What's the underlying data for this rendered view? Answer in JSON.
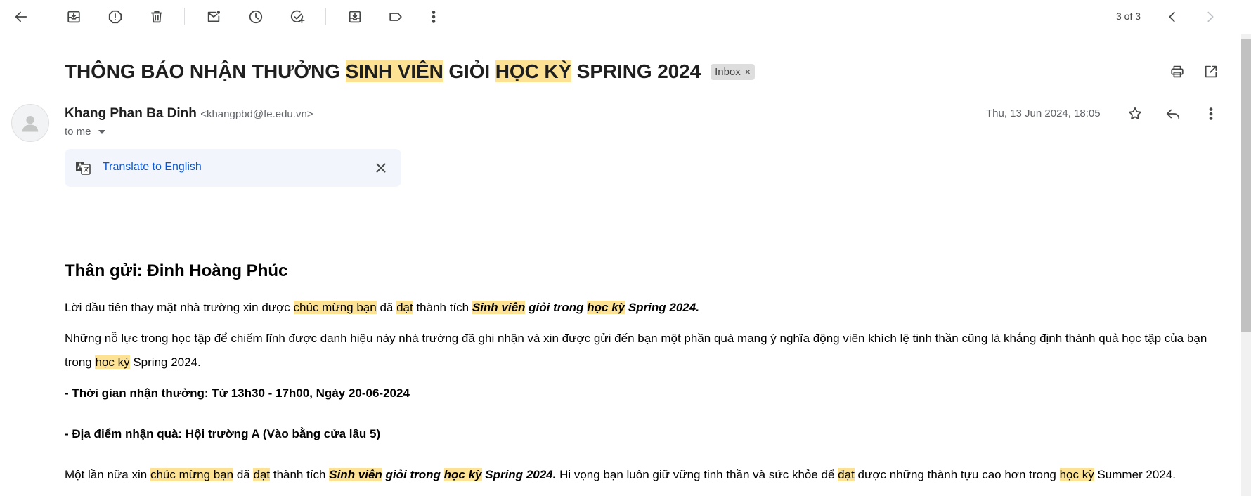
{
  "toolbar": {
    "pager_text": "3 of 3",
    "icons": [
      "back-icon",
      "archive-icon",
      "report-spam-icon",
      "delete-icon",
      "mark-unread-icon",
      "snooze-icon",
      "add-task-icon",
      "move-to-icon",
      "label-icon",
      "more-vert-icon",
      "prev-icon",
      "next-icon"
    ]
  },
  "email": {
    "subject_parts": [
      "THÔNG BÁO NHẬN THƯỞNG ",
      "SINH VIÊN",
      " GIỎI ",
      "HỌC KỲ",
      " SPRING 2024"
    ],
    "label": "Inbox",
    "label_close": "×",
    "sender_name": "Khang Phan Ba Dinh",
    "sender_email": "<khangpbd@fe.edu.vn>",
    "to": "to me",
    "date": "Thu, 13 Jun 2024, 18:05"
  },
  "translate": {
    "link": "Translate to English"
  },
  "body": {
    "greeting": "Thân gửi: Đinh Hoàng Phúc",
    "p1": [
      "Lời đầu tiên thay mặt nhà trường xin được ",
      "chúc mừng bạn",
      " đã ",
      "đạt",
      " thành tích ",
      "Sinh viên",
      " giỏi trong ",
      "học kỳ",
      " Spring 2024."
    ],
    "p2": [
      "Những nỗ lực trong học tập để chiếm lĩnh được danh hiệu này nhà trường đã ghi nhận và xin được gửi đến bạn một phần quà mang ý nghĩa động viên khích lệ tinh thần cũng là khẳng định thành quả học tập của bạn trong ",
      "học kỳ",
      " Spring 2024."
    ],
    "time_line": "- Thời gian nhận thưởng: Từ 13h30 - 17h00, Ngày 20-06-2024",
    "place_line": "- Địa điểm nhận quà: Hội trường A (Vào bằng cửa lầu 5)",
    "p3": [
      "Một lần nữa xin ",
      "chúc mừng bạn",
      " đã ",
      "đạt",
      " thành tích ",
      "Sinh viên",
      " giỏi trong ",
      "học kỳ",
      " Spring 2024.",
      " Hi vọng bạn luôn giữ vững tinh thần và sức khỏe để ",
      "đạt",
      " được những thành tựu cao hơn trong ",
      "học kỳ",
      " Summer 2024."
    ]
  },
  "colors": {
    "highlight": "#fde293",
    "link": "#0b57d0",
    "translate_bg": "#f2f6fc"
  }
}
